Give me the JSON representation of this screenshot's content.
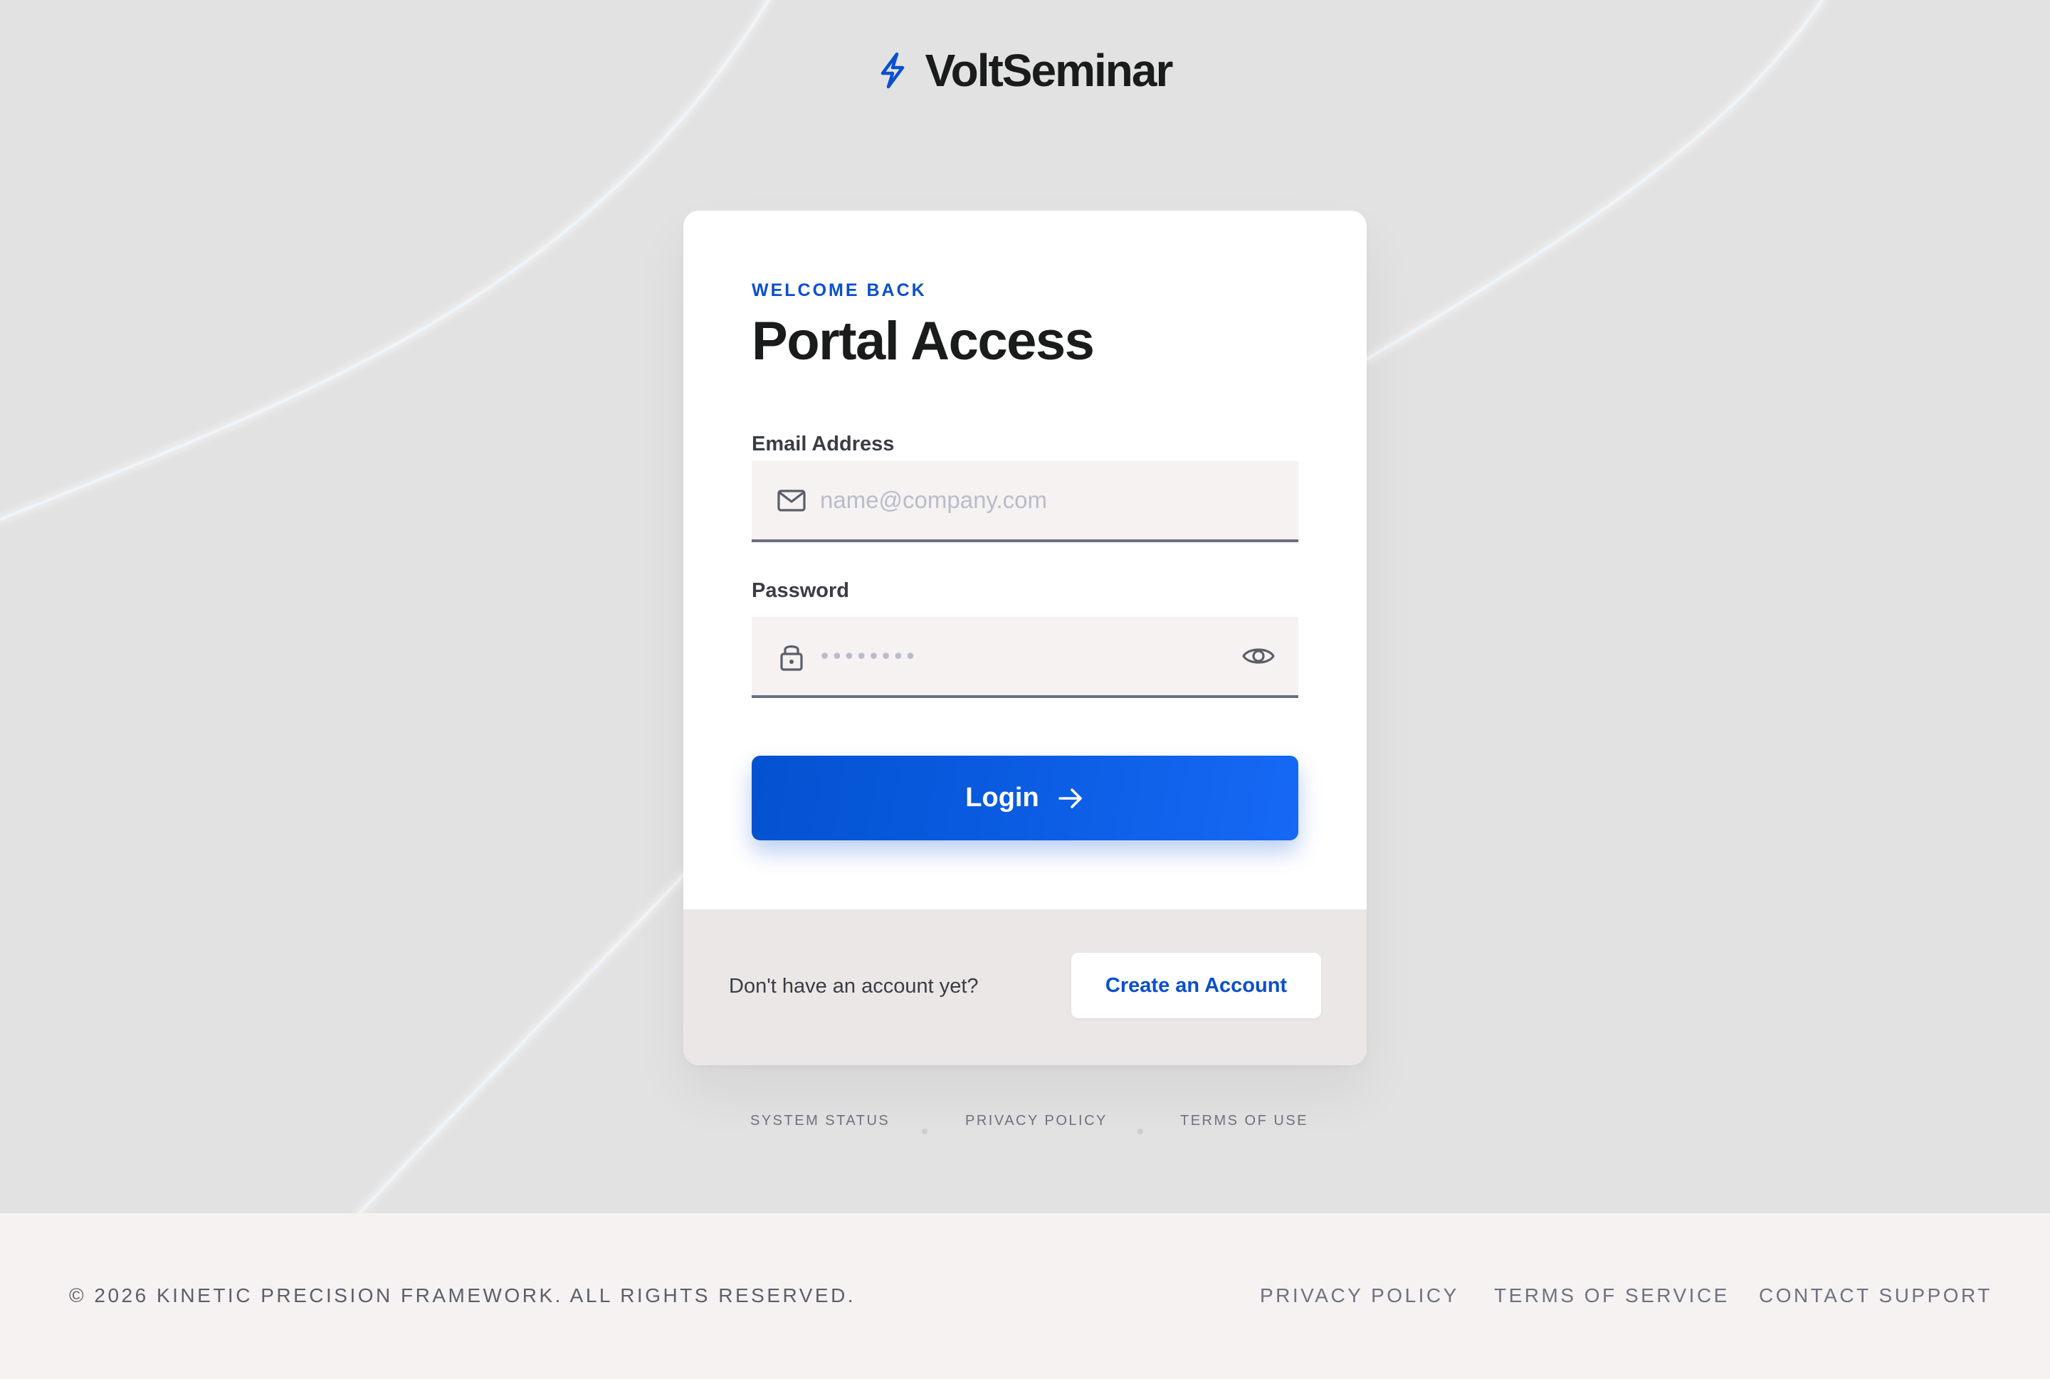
{
  "brand": {
    "name": "VoltSeminar",
    "icon": "lightning-bolt-icon",
    "accent_color": "#0a4fcf"
  },
  "card": {
    "eyebrow": "WELCOME BACK",
    "title": "Portal Access",
    "email": {
      "label": "Email Address",
      "placeholder": "name@company.com",
      "value": "",
      "icon": "envelope-icon"
    },
    "password": {
      "label": "Password",
      "masked_value": "••••••••",
      "icon": "lock-icon",
      "toggle_icon": "eye-icon"
    },
    "login_button": {
      "label": "Login",
      "icon": "arrow-right-icon"
    },
    "footer": {
      "prompt": "Don't have an account yet?",
      "create_account_label": "Create an Account"
    }
  },
  "mini_links": [
    "SYSTEM STATUS",
    "PRIVACY POLICY",
    "TERMS OF USE"
  ],
  "page_footer": {
    "copyright": "© 2026 KINETIC PRECISION FRAMEWORK. ALL RIGHTS RESERVED.",
    "links": [
      "PRIVACY POLICY",
      "TERMS OF SERVICE",
      "CONTACT SUPPORT"
    ]
  },
  "colors": {
    "background": "#e3e2e2",
    "card_background": "#ffffff",
    "card_footer_background": "#ebe7e6",
    "input_background": "#f5f2f1",
    "button_gradient_start": "#0352d1",
    "button_gradient_end": "#1669f5",
    "page_footer_background": "#f5f2f1"
  }
}
